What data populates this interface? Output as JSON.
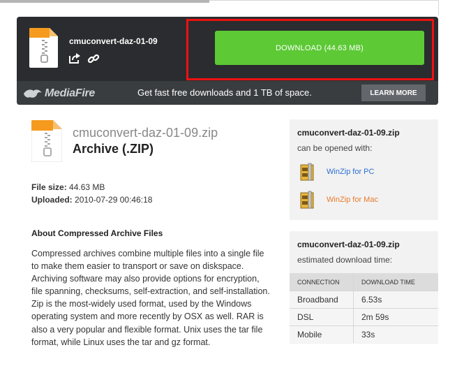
{
  "banner": {
    "file_name": "cmuconvert-daz-01-09",
    "download_label": "DOWNLOAD (44.63 MB)",
    "brand_name": "MediaFire",
    "promo_text": "Get fast free downloads and 1 TB of space.",
    "learn_more_label": "LEARN MORE"
  },
  "file": {
    "full_name": "cmuconvert-daz-01-09.zip",
    "type_label": "Archive (.ZIP)",
    "size_label": "File size:",
    "size_value": "44.63 MB",
    "uploaded_label": "Uploaded:",
    "uploaded_value": "2010-07-29 00:46:18"
  },
  "about": {
    "heading": "About Compressed Archive Files",
    "text": "Compressed archives combine multiple files into a single file to make them easier to transport or save on diskspace. Archiving software may also provide options for encryption, file spanning, checksums, self-extraction, and self-installation. Zip is the most-widely used format, used by the Windows operating system and more recently by OSX as well. RAR is also a very popular and flexible format. Unix uses the tar file format, while Linux uses the tar and gz format."
  },
  "open_with": {
    "file_name": "cmuconvert-daz-01-09.zip",
    "subtitle": "can be opened with:",
    "apps": [
      {
        "label": "WinZip for PC",
        "color": "#2a6fd0",
        "icon": "winzip-icon"
      },
      {
        "label": "WinZip for Mac",
        "color": "#e87a2c",
        "icon": "winzip-icon"
      }
    ]
  },
  "download_time": {
    "file_name": "cmuconvert-daz-01-09.zip",
    "subtitle": "estimated download time:",
    "headers": [
      "CONNECTION",
      "DOWNLOAD TIME"
    ],
    "rows": [
      {
        "connection": "Broadband",
        "time": "6.53s"
      },
      {
        "connection": "DSL",
        "time": "2m 59s"
      },
      {
        "connection": "Mobile",
        "time": "33s"
      }
    ]
  },
  "colors": {
    "download_green": "#5cc935",
    "highlight_red": "#ee1111",
    "banner_dark": "#2a2c2f"
  }
}
